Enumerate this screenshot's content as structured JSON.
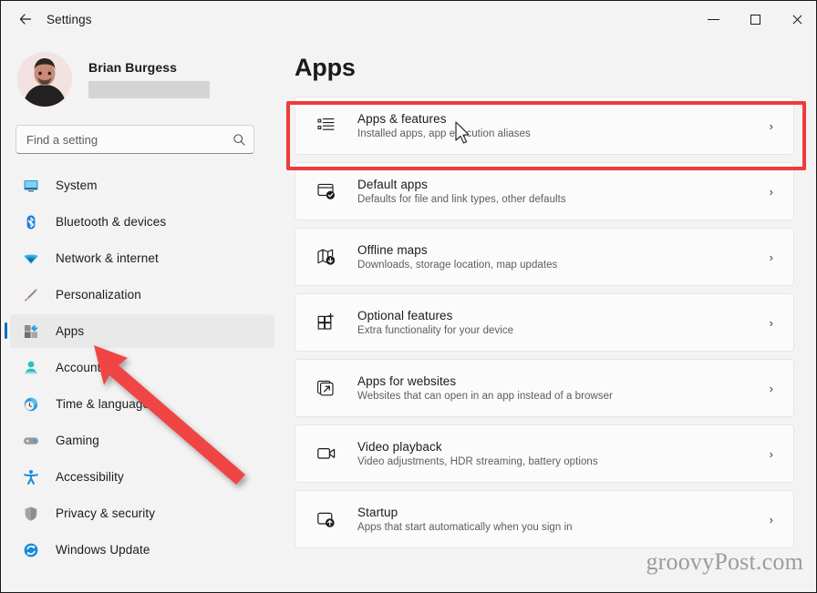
{
  "window": {
    "title": "Settings",
    "back_icon": "back-arrow-icon",
    "minimize_label": "Minimize",
    "maximize_label": "Maximize",
    "close_label": "Close"
  },
  "profile": {
    "name": "Brian Burgess",
    "email_redacted": true,
    "avatar_alt": "user-avatar"
  },
  "search": {
    "placeholder": "Find a setting",
    "value": "",
    "icon": "search-icon"
  },
  "sidebar": {
    "items": [
      {
        "label": "System",
        "icon": "monitor-icon",
        "selected": false
      },
      {
        "label": "Bluetooth & devices",
        "icon": "bluetooth-icon",
        "selected": false
      },
      {
        "label": "Network & internet",
        "icon": "wifi-icon",
        "selected": false
      },
      {
        "label": "Personalization",
        "icon": "paintbrush-icon",
        "selected": false
      },
      {
        "label": "Apps",
        "icon": "apps-icon",
        "selected": true
      },
      {
        "label": "Accounts",
        "icon": "person-icon",
        "selected": false
      },
      {
        "label": "Time & language",
        "icon": "clock-globe-icon",
        "selected": false
      },
      {
        "label": "Gaming",
        "icon": "gamepad-icon",
        "selected": false
      },
      {
        "label": "Accessibility",
        "icon": "accessibility-icon",
        "selected": false
      },
      {
        "label": "Privacy & security",
        "icon": "shield-icon",
        "selected": false
      },
      {
        "label": "Windows Update",
        "icon": "update-icon",
        "selected": false
      }
    ]
  },
  "main": {
    "page_title": "Apps",
    "cards": [
      {
        "title": "Apps & features",
        "subtitle": "Installed apps, app execution aliases",
        "icon": "list-bullets-icon",
        "chevron": "›",
        "highlighted": true
      },
      {
        "title": "Default apps",
        "subtitle": "Defaults for file and link types, other defaults",
        "icon": "window-check-icon",
        "chevron": "›",
        "highlighted": false
      },
      {
        "title": "Offline maps",
        "subtitle": "Downloads, storage location, map updates",
        "icon": "map-download-icon",
        "chevron": "›",
        "highlighted": false
      },
      {
        "title": "Optional features",
        "subtitle": "Extra functionality for your device",
        "icon": "grid-plus-icon",
        "chevron": "›",
        "highlighted": false
      },
      {
        "title": "Apps for websites",
        "subtitle": "Websites that can open in an app instead of a browser",
        "icon": "external-link-icon",
        "chevron": "›",
        "highlighted": false
      },
      {
        "title": "Video playback",
        "subtitle": "Video adjustments, HDR streaming, battery options",
        "icon": "video-camera-icon",
        "chevron": "›",
        "highlighted": false
      },
      {
        "title": "Startup",
        "subtitle": "Apps that start automatically when you sign in",
        "icon": "startup-arrow-icon",
        "chevron": "›",
        "highlighted": false
      }
    ]
  },
  "annotations": {
    "highlight_color": "#ef3b3b",
    "arrow_color": "#f04545",
    "arrow_target": "Apps",
    "cursor_icon": "mouse-pointer-icon"
  },
  "watermark": {
    "text": "groovyPost.com"
  },
  "colors": {
    "accent": "#0f6cbd",
    "window_bg": "#f3f3f3",
    "card_bg": "#fbfbfb",
    "text_primary": "#1b1b1b",
    "text_secondary": "#5d5d5d"
  }
}
